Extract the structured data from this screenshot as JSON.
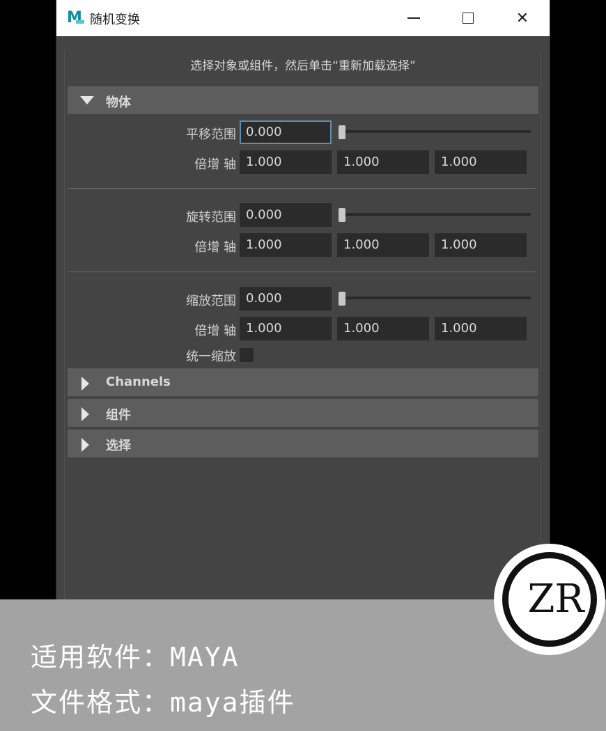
{
  "window": {
    "title": "随机变换",
    "app_icon_letter": "M"
  },
  "instruction": "选择对象或组件，然后单击“重新加载选择”",
  "sections": {
    "objects": {
      "label": "物体",
      "expanded": true
    },
    "channels": {
      "label": "Channels",
      "expanded": false
    },
    "components": {
      "label": "组件",
      "expanded": false
    },
    "selection": {
      "label": "选择",
      "expanded": false
    }
  },
  "translate": {
    "range_label": "平移范围",
    "range_value": "0.000",
    "slider_value": 0,
    "axis_label": "倍增 轴",
    "axis": [
      "1.000",
      "1.000",
      "1.000"
    ]
  },
  "rotate": {
    "range_label": "旋转范围",
    "range_value": "0.000",
    "slider_value": 0,
    "axis_label": "倍增 轴",
    "axis": [
      "1.000",
      "1.000",
      "1.000"
    ]
  },
  "scale": {
    "range_label": "缩放范围",
    "range_value": "0.000",
    "slider_value": 0,
    "axis_label": "倍增 轴",
    "axis": [
      "1.000",
      "1.000",
      "1.000"
    ],
    "uniform_label": "统一缩放",
    "uniform_checked": false
  },
  "banner": {
    "line1": "适用软件：MAYA",
    "line2": "文件格式：maya插件"
  },
  "logo": {
    "text": "ZR"
  },
  "colors": {
    "panel": "#444444",
    "field": "#2b2b2b",
    "header": "#5d5d5d",
    "focus": "#5e8fb0"
  }
}
